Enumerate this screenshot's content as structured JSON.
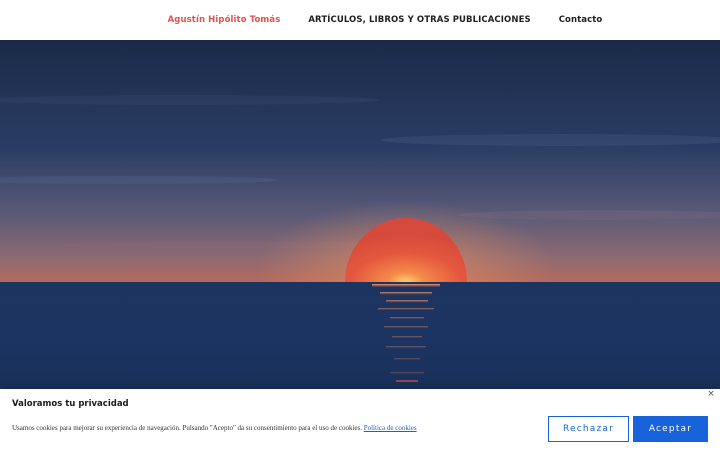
{
  "nav": {
    "items": [
      {
        "label": "Agustín Hipólito Tomás",
        "active": true
      },
      {
        "label": "ARTÍCULOS, LIBROS Y OTRAS PUBLICACIONES",
        "active": false
      },
      {
        "label": "Contacto",
        "active": false
      }
    ]
  },
  "hero": {
    "image": "sunset-over-sea"
  },
  "cookie": {
    "title": "Valoramos tu privacidad",
    "text": "Usamos cookies para mejorar su experiencia de navegación. Pulsando \"Acepto\" da su consentimiento para el uso de cookies.",
    "policy_link": "Política de cookies",
    "reject_label": "Rechazar",
    "accept_label": "Aceptar",
    "close_glyph": "×"
  },
  "colors": {
    "accent": "#e0524f",
    "button": "#1863dc",
    "sky_top": "#1b2a48",
    "sea": "#1c3360",
    "sun": "#e8563f"
  }
}
